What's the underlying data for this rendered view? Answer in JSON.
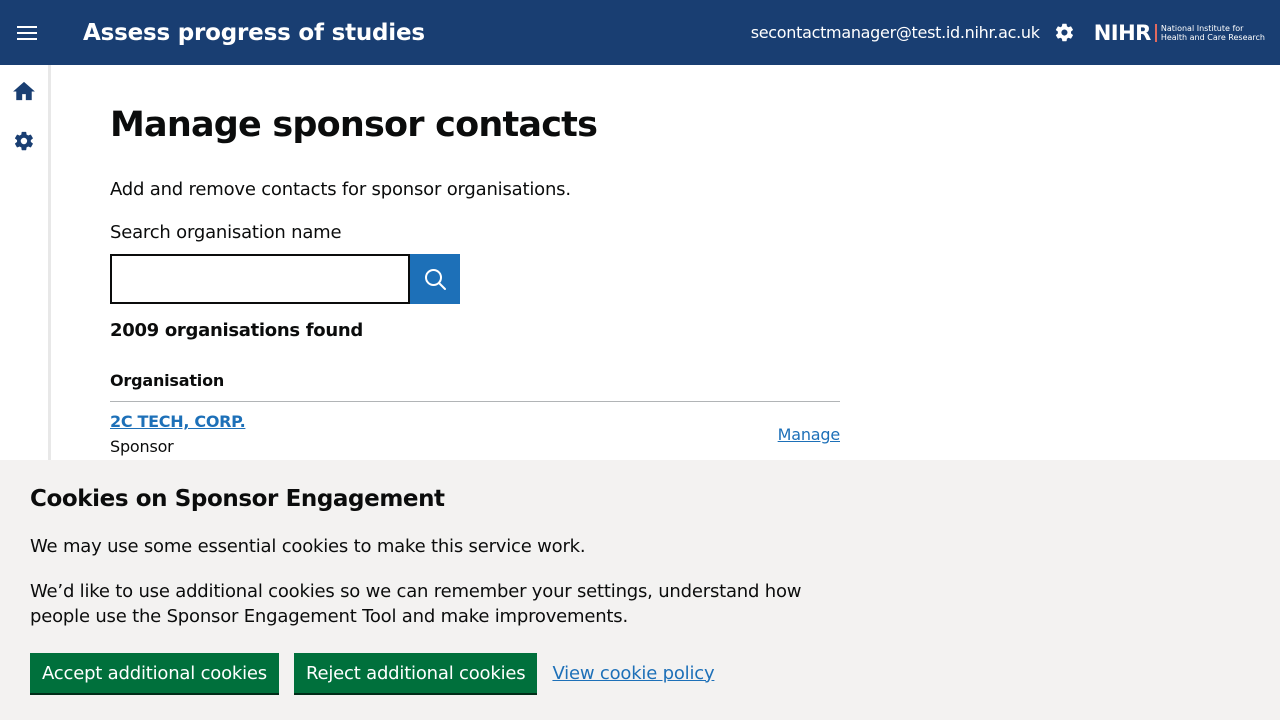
{
  "header": {
    "title": "Assess progress of studies",
    "user_email": "secontactmanager@test.id.nihr.ac.uk",
    "logo_mark": "NIHR",
    "logo_line1": "National Institute for",
    "logo_line2": "Health and Care Research",
    "icons": {
      "menu": "menu-icon",
      "settings": "gear-icon"
    }
  },
  "sidebar": {
    "items": [
      {
        "icon": "home-icon"
      },
      {
        "icon": "gear-icon"
      }
    ]
  },
  "main": {
    "title": "Manage sponsor contacts",
    "lead": "Add and remove contacts for sponsor organisations.",
    "search_label": "Search organisation name",
    "search_value": "",
    "search_icon": "search-icon",
    "result_count": "2009 organisations found",
    "table_header": "Organisation",
    "rows": [
      {
        "name": "2C TECH, CORP.",
        "type": "Sponsor",
        "action": "Manage"
      }
    ]
  },
  "cookie_banner": {
    "title": "Cookies on Sponsor Engagement",
    "p1": "We may use some essential cookies to make this service work.",
    "p2": "We’d like to use additional cookies so we can remember your settings, understand how people use the Sponsor Engagement Tool and make improvements.",
    "accept_label": "Accept additional cookies",
    "reject_label": "Reject additional cookies",
    "policy_link": "View cookie policy"
  },
  "colors": {
    "header_bg": "#193e72",
    "link": "#1d70b8",
    "button_green": "#00703c",
    "banner_bg": "#f3f2f1"
  }
}
